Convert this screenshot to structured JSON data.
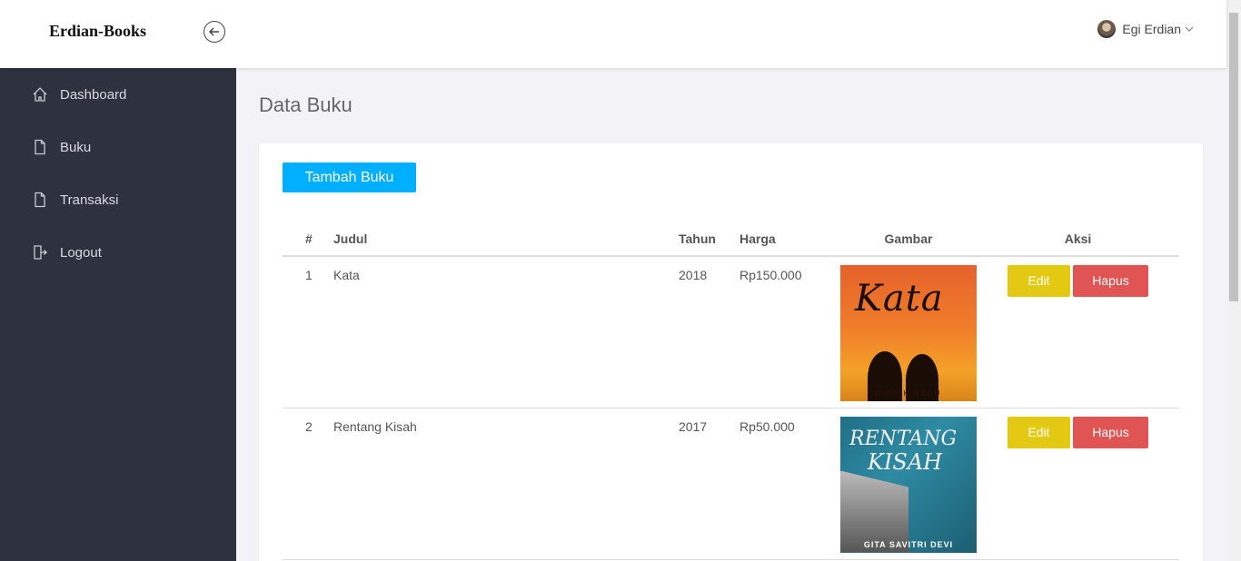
{
  "app": {
    "brand": "Erdian-Books"
  },
  "user": {
    "name": "Egi Erdian"
  },
  "sidebar": {
    "items": [
      {
        "label": "Dashboard",
        "icon": "home-icon"
      },
      {
        "label": "Buku",
        "icon": "file-icon"
      },
      {
        "label": "Transaksi",
        "icon": "file-icon"
      },
      {
        "label": "Logout",
        "icon": "logout-icon"
      }
    ]
  },
  "main": {
    "title": "Data Buku",
    "add_button": "Tambah Buku",
    "table": {
      "headers": [
        "#",
        "Judul",
        "Tahun",
        "Harga",
        "Gambar",
        "Aksi"
      ],
      "rows": [
        {
          "no": "1",
          "judul": "Kata",
          "tahun": "2018",
          "harga": "Rp150.000",
          "cover_title": "Kata",
          "cover_author": "RINTIK SEDU"
        },
        {
          "no": "2",
          "judul": "Rentang Kisah",
          "tahun": "2017",
          "harga": "Rp50.000",
          "cover_title_1": "RENTANG",
          "cover_title_2": "KISAH",
          "cover_author": "GITA SAVITRI DEVI"
        }
      ],
      "edit_label": "Edit",
      "delete_label": "Hapus"
    }
  },
  "colors": {
    "sidebar_bg": "#2d323e",
    "primary": "#00b0ff",
    "warning": "#e3c912",
    "danger": "#e05454"
  }
}
